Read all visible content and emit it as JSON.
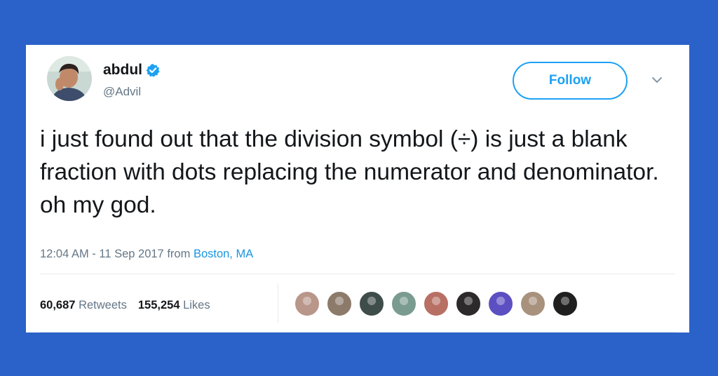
{
  "colors": {
    "background": "#2a62c9",
    "card": "#ffffff",
    "text": "#14171a",
    "muted": "#657786",
    "link": "#1b95e0",
    "follow": "#1da1f2",
    "verified": "#1da1f2"
  },
  "user": {
    "display_name": "abdul",
    "handle": "@Advil",
    "verified": true,
    "avatar_icon": "user-photo"
  },
  "follow_button": {
    "label": "Follow"
  },
  "menu": {
    "icon": "chevron-down-icon"
  },
  "tweet": {
    "text": "i just found out that the division symbol (÷) is just a blank fraction with dots replacing the numerator and denominator. oh my god.",
    "time": "12:04 AM - 11 Sep 2017",
    "from_label": "from",
    "location": "Boston, MA"
  },
  "stats": {
    "retweets_count": "60,687",
    "retweets_label": "Retweets",
    "likes_count": "155,254",
    "likes_label": "Likes"
  },
  "likers": [
    {
      "icon": "user-photo",
      "color": "#b9968a"
    },
    {
      "icon": "user-photo",
      "color": "#8c7a6a"
    },
    {
      "icon": "user-photo",
      "color": "#3f4d4a"
    },
    {
      "icon": "user-photo",
      "color": "#7a9b8f"
    },
    {
      "icon": "user-photo",
      "color": "#b77063"
    },
    {
      "icon": "user-photo",
      "color": "#2c2a2a"
    },
    {
      "icon": "user-photo",
      "color": "#5b4fc2"
    },
    {
      "icon": "user-photo",
      "color": "#a8917d"
    },
    {
      "icon": "user-photo",
      "color": "#1f1f1f"
    }
  ]
}
